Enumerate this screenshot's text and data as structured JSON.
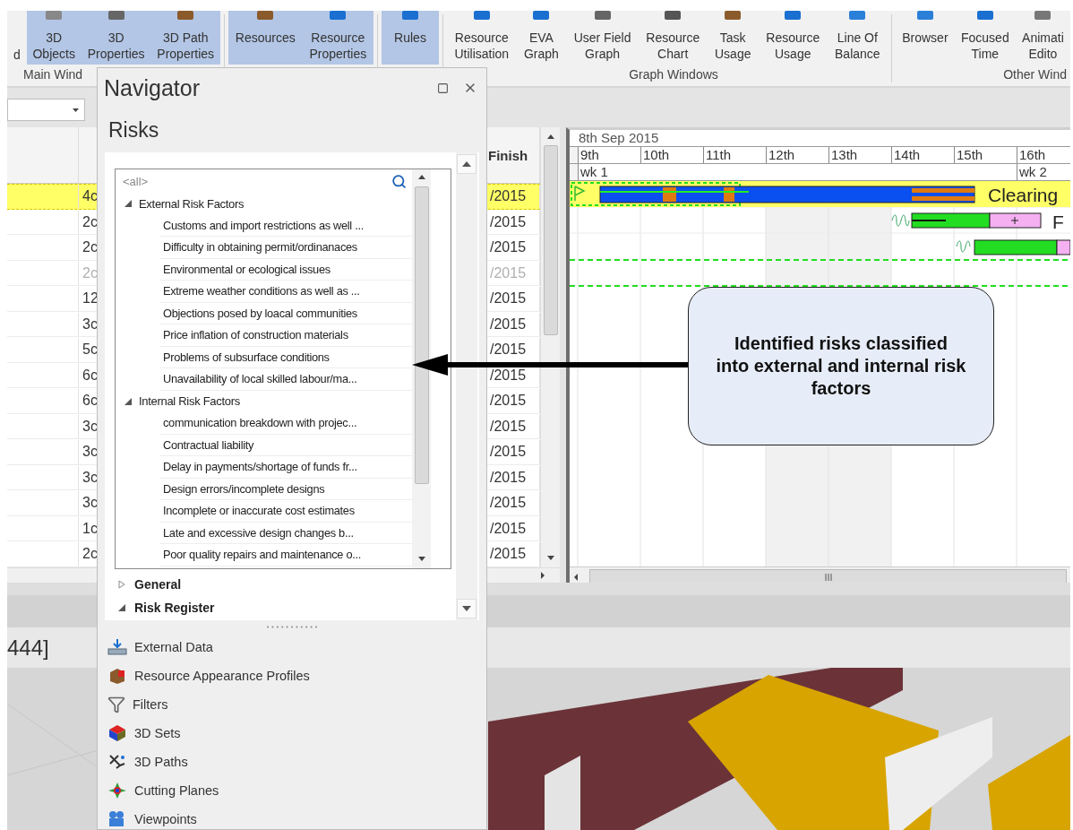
{
  "ribbon": {
    "groups": [
      {
        "label": "Main Wind",
        "buttons": [
          {
            "lines": [
              "d"
            ],
            "selected": false
          },
          {
            "lines": [
              "3D",
              "Objects"
            ],
            "selected": true
          },
          {
            "lines": [
              "3D",
              "Properties"
            ],
            "selected": true
          },
          {
            "lines": [
              "3D Path",
              "Properties"
            ],
            "selected": true
          }
        ]
      },
      {
        "buttons": [
          {
            "lines": [
              "Resources"
            ],
            "selected": true
          },
          {
            "lines": [
              "Resource",
              "Properties"
            ],
            "selected": true
          }
        ]
      },
      {
        "buttons": [
          {
            "lines": [
              "Rules"
            ],
            "selected": true
          }
        ]
      },
      {
        "label": "Graph Windows",
        "buttons": [
          {
            "lines": [
              "Resource",
              "Utilisation"
            ],
            "selected": false
          },
          {
            "lines": [
              "EVA",
              "Graph"
            ],
            "selected": false
          },
          {
            "lines": [
              "User Field",
              "Graph"
            ],
            "selected": false
          },
          {
            "lines": [
              "Resource",
              "Chart"
            ],
            "selected": false
          },
          {
            "lines": [
              "Task",
              "Usage"
            ],
            "selected": false
          },
          {
            "lines": [
              "Resource",
              "Usage"
            ],
            "selected": false
          },
          {
            "lines": [
              "Line Of",
              "Balance"
            ],
            "selected": false
          }
        ]
      },
      {
        "label": "Other Wind",
        "buttons": [
          {
            "lines": [
              "Browser"
            ],
            "selected": false
          },
          {
            "lines": [
              "Focused",
              "Time"
            ],
            "selected": false
          },
          {
            "lines": [
              "Animati",
              "Edito"
            ],
            "selected": false
          }
        ]
      }
    ]
  },
  "table": {
    "finish_header": "Finish",
    "rows": [
      {
        "column_2": "4c",
        "finish": "/2015",
        "selected": true,
        "disabled": false
      },
      {
        "column_2": "2c",
        "finish": "/2015",
        "selected": false,
        "disabled": false
      },
      {
        "column_2": "2c",
        "finish": "/2015",
        "selected": false,
        "disabled": false
      },
      {
        "column_2": "2c",
        "finish": "/2015",
        "selected": false,
        "disabled": true
      },
      {
        "column_2": "12",
        "finish": "/2015",
        "selected": false,
        "disabled": false
      },
      {
        "column_2": "3c",
        "finish": "/2015",
        "selected": false,
        "disabled": false
      },
      {
        "column_2": "5c",
        "finish": "/2015",
        "selected": false,
        "disabled": false
      },
      {
        "column_2": "6c",
        "finish": "/2015",
        "selected": false,
        "disabled": false
      },
      {
        "column_2": "6c",
        "finish": "/2015",
        "selected": false,
        "disabled": false
      },
      {
        "column_2": "3c",
        "finish": "/2015",
        "selected": false,
        "disabled": false
      },
      {
        "column_2": "3c",
        "finish": "/2015",
        "selected": false,
        "disabled": false
      },
      {
        "column_2": "3c",
        "finish": "/2015",
        "selected": false,
        "disabled": false
      },
      {
        "column_2": "3c",
        "finish": "/2015",
        "selected": false,
        "disabled": false
      },
      {
        "column_2": "1c",
        "finish": "/2015",
        "selected": false,
        "disabled": false
      },
      {
        "column_2": "2c",
        "finish": "/2015",
        "selected": false,
        "disabled": false
      }
    ]
  },
  "gantt": {
    "date": "8th Sep 2015",
    "days": [
      "9th",
      "10th",
      "11th",
      "12th",
      "13th",
      "14th",
      "15th",
      "16th"
    ],
    "weeks": [
      "wk 1",
      "wk 2"
    ],
    "task_labels": [
      "Clearing",
      "F"
    ]
  },
  "status_text": "444]",
  "navigator": {
    "title": "Navigator",
    "section": "Risks",
    "search_placeholder": "<all>",
    "tree": [
      {
        "label": "External Risk Factors",
        "expanded": true,
        "children": [
          {
            "label": "Customs and import restrictions as well ..."
          },
          {
            "label": "Difficulty in obtaining permit/ordinanaces"
          },
          {
            "label": "Environmental or ecological issues"
          },
          {
            "label": "Extreme weather conditions as well as ..."
          },
          {
            "label": "Objections posed by loacal communities"
          },
          {
            "label": "Price inflation of construction materials"
          },
          {
            "label": "Problems of subsurface conditions"
          },
          {
            "label": "Unavailability of local skilled labour/ma..."
          }
        ]
      },
      {
        "label": "Internal Risk Factors",
        "expanded": true,
        "children": [
          {
            "label": "communication breakdown with projec..."
          },
          {
            "label": "Contractual liability"
          },
          {
            "label": "Delay in payments/shortage of funds fr..."
          },
          {
            "label": "Design errors/incomplete designs"
          },
          {
            "label": "Incomplete or inaccurate cost estimates"
          },
          {
            "label": "Late and excessive design changes b..."
          },
          {
            "label": "Poor quality repairs and maintenance o..."
          }
        ]
      }
    ],
    "sections": [
      {
        "label": "General",
        "expanded": false
      },
      {
        "label": "Risk Register",
        "expanded": true
      }
    ],
    "panels": [
      "External Data",
      "Resource Appearance Profiles",
      "Filters",
      "3D Sets",
      "3D Paths",
      "Cutting Planes",
      "Viewpoints"
    ]
  },
  "callout": "Identified risks classified into external and internal risk factors"
}
